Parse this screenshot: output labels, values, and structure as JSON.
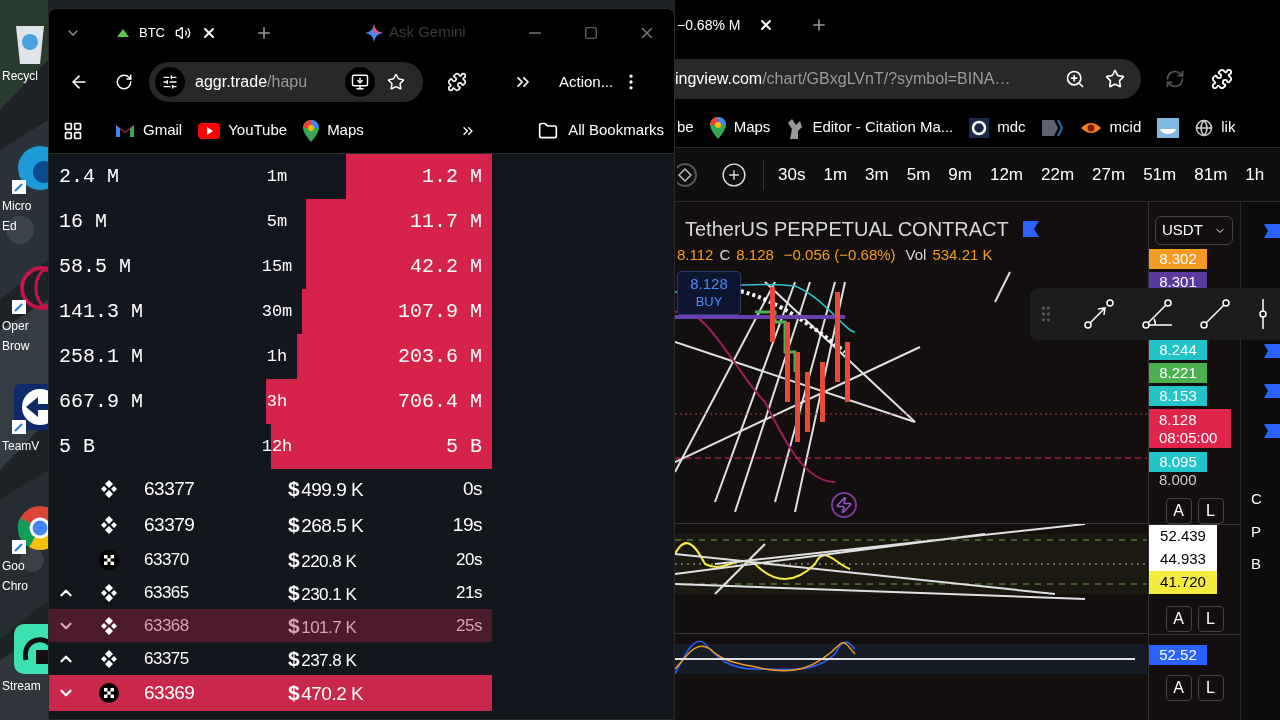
{
  "desktop_icons": [
    {
      "kind": "recycle",
      "lines": [
        "Recycl"
      ]
    },
    {
      "kind": "edge",
      "lines": [
        "Micro",
        "Ed"
      ]
    },
    {
      "kind": "opera",
      "lines": [
        "Oper",
        "Brow"
      ]
    },
    {
      "kind": "teamviewer",
      "lines": [
        "TeamV"
      ]
    },
    {
      "kind": "chrome",
      "lines": [
        "Goo",
        "Chro"
      ]
    },
    {
      "kind": "stream",
      "lines": [
        "Stream"
      ]
    }
  ],
  "left_window": {
    "tab": {
      "title": "BTC",
      "selected": true
    },
    "gemini_label": "Ask Gemini",
    "address": {
      "host": "aggr.trade",
      "path": "/hapu"
    },
    "action_label": "Action...",
    "bookmarks": [
      {
        "kind": "gmail",
        "label": "Gmail"
      },
      {
        "kind": "youtube",
        "label": "YouTube"
      },
      {
        "kind": "maps",
        "label": "Maps"
      }
    ],
    "all_bookmarks": "All Bookmarks",
    "stats": [
      {
        "left": "2.4 M",
        "period": "1m",
        "right": "1.2 M",
        "level": 0.33
      },
      {
        "left": "16 M",
        "period": "5m",
        "right": "11.7 M",
        "level": 0.42
      },
      {
        "left": "58.5 M",
        "period": "15m",
        "right": "42.2 M",
        "level": 0.42
      },
      {
        "left": "141.3 M",
        "period": "30m",
        "right": "107.9 M",
        "level": 0.43
      },
      {
        "left": "258.1 M",
        "period": "1h",
        "right": "203.6 M",
        "level": 0.44
      },
      {
        "left": "667.9 M",
        "period": "3h",
        "right": "706.4 M",
        "level": 0.51
      },
      {
        "left": "5 B",
        "period": "12h",
        "right": "5 B",
        "level": 0.5
      }
    ],
    "trades": [
      {
        "kind": "binance",
        "up": false,
        "down": false,
        "price": "63377",
        "currency": "$",
        "amount": "499.9 K",
        "time": "0s",
        "highlighted": false,
        "large": true
      },
      {
        "kind": "binance",
        "up": false,
        "down": false,
        "price": "63379",
        "currency": "$",
        "amount": "268.5 K",
        "time": "19s",
        "highlighted": false,
        "large": true
      },
      {
        "kind": "okx",
        "up": false,
        "down": false,
        "price": "63370",
        "currency": "$",
        "amount": "220.8 K",
        "time": "20s",
        "highlighted": false,
        "large": false
      },
      {
        "kind": "binance",
        "up": true,
        "down": false,
        "price": "63365",
        "currency": "$",
        "amount": "230.1 K",
        "time": "21s",
        "highlighted": false,
        "large": false
      },
      {
        "kind": "binance",
        "up": false,
        "down": true,
        "price": "63368",
        "currency": "$",
        "amount": "101.7 K",
        "time": "25s",
        "highlighted": true,
        "large": false
      },
      {
        "kind": "binance",
        "up": true,
        "down": false,
        "price": "63375",
        "currency": "$",
        "amount": "237.8 K",
        "highlighted": false,
        "large": false
      },
      {
        "kind": "okx",
        "up": false,
        "down": true,
        "price": "63369",
        "currency": "$",
        "amount": "470.2 K",
        "highlighted": true,
        "large": true
      }
    ]
  },
  "right_window": {
    "tab_title": "−0.68% M",
    "address": {
      "host": "ingview.com",
      "path": "/chart/GBxgLVnT/?symbol=BINA…"
    },
    "bookmarks": [
      {
        "kind": "text",
        "label": "be"
      },
      {
        "kind": "maps",
        "label": "Maps"
      },
      {
        "kind": "squirrel",
        "label": "Editor - Citation Ma..."
      },
      {
        "kind": "ring",
        "label": "mdc"
      },
      {
        "kind": "arrow"
      },
      {
        "kind": "eye",
        "label": "mcid"
      },
      {
        "kind": "whale"
      },
      {
        "kind": "globe",
        "label": "lik"
      }
    ],
    "timeframes": [
      "30s",
      "1m",
      "3m",
      "5m",
      "9m",
      "12m",
      "22m",
      "27m",
      "51m",
      "81m",
      "1h"
    ],
    "chart": {
      "symbol": "TetherUS PERPETUAL CONTRACT",
      "legend": {
        "open": "8.112",
        "close_prefix": "C",
        "close": "8.128",
        "change": "−0.056 (−0.68%)",
        "vol_label": "Vol",
        "vol": "534.21 K"
      },
      "buy": {
        "price": "8.128",
        "label": "BUY"
      },
      "currency": "USDT",
      "price_labels": [
        {
          "text": "8.302",
          "color": "#f59a23"
        },
        {
          "text": "8.301",
          "color": "#5b3aa0"
        },
        {
          "text": "8.244",
          "color": "#22c4c9"
        },
        {
          "text": "8.221",
          "color": "#4caf50"
        },
        {
          "text": "8.153",
          "color": "#22c4c9"
        }
      ],
      "last_price": {
        "price": "8.128",
        "countdown": "08:05:00"
      },
      "low_label": {
        "text": "8.095",
        "color": "#22c4c9"
      },
      "axis_label": "8.000",
      "panes": [
        {
          "buttons": [
            "A",
            "L"
          ]
        },
        {
          "values": [
            {
              "text": "52.439",
              "color": "#ffffff"
            },
            {
              "text": "44.933",
              "color": "#ffffff"
            },
            {
              "text": "41.720",
              "color": "#f5ec42"
            }
          ],
          "buttons": [
            "A",
            "L"
          ]
        },
        {
          "values": [
            {
              "text": "52.52",
              "color": "#2962ff"
            }
          ],
          "buttons": [
            "A",
            "L"
          ]
        }
      ]
    },
    "sidebar_letters": [
      "C",
      "P",
      "B"
    ]
  }
}
